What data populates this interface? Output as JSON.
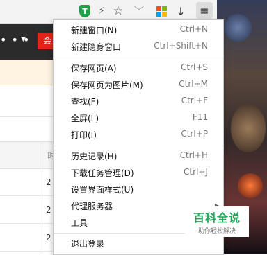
{
  "toolbar": {
    "icons": [
      "shield-icon",
      "lightning-icon",
      "star-icon",
      "chevron-down-icon",
      "app-grid-icon",
      "download-icon",
      "menu-icon"
    ],
    "shield_glyph": "T",
    "lightning_glyph": "⚡",
    "star_glyph": "☆",
    "chevron_glyph": "﹀",
    "download_glyph": "↓",
    "menu_glyph": "≡"
  },
  "page": {
    "nav_dots": "• • •",
    "red_button_text": "会",
    "header_cell": "时",
    "rows": [
      "2",
      "2",
      "2"
    ]
  },
  "menu": {
    "groups": [
      [
        {
          "label": "新建窗口(N)",
          "shortcut": "Ctrl+N"
        },
        {
          "label": "新建隐身窗口",
          "shortcut": "Ctrl+Shift+N"
        }
      ],
      [
        {
          "label": "保存网页(A)",
          "shortcut": "Ctrl+S"
        },
        {
          "label": "保存网页为图片(M)",
          "shortcut": "Ctrl+M"
        },
        {
          "label": "查找(F)",
          "shortcut": "Ctrl+F"
        },
        {
          "label": "全屏(L)",
          "shortcut": "F11"
        },
        {
          "label": "打印(I)",
          "shortcut": "Ctrl+P"
        }
      ],
      [
        {
          "label": "历史记录(H)",
          "shortcut": "Ctrl+H"
        },
        {
          "label": "下载任务管理(D)",
          "shortcut": "Ctrl+J"
        },
        {
          "label": "设置界面样式(U)",
          "shortcut": ""
        },
        {
          "label": "代理服务器",
          "shortcut": "",
          "submenu": true
        },
        {
          "label": "工具",
          "shortcut": "",
          "submenu": true
        }
      ],
      [
        {
          "label": "退出登录",
          "shortcut": ""
        }
      ]
    ]
  },
  "watermark": {
    "title": "百科全说",
    "subtitle": "助你轻松解决"
  },
  "colors": {
    "shield": "#20a04a",
    "red_button": "#e2231a",
    "watermark_green": "#21a55a",
    "notice_bar": "#fef4e1"
  }
}
